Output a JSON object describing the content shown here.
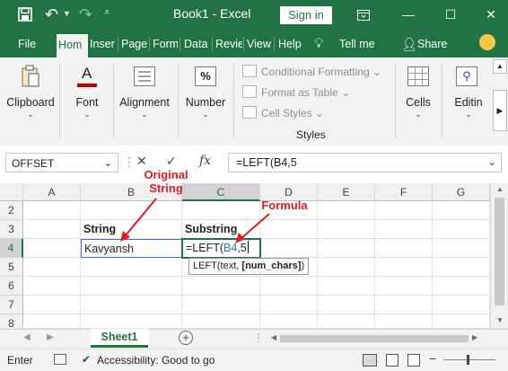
{
  "titlebar": {
    "title": "Book1 - Excel",
    "sign_in": "Sign in",
    "accent": "#217346"
  },
  "tabs": [
    "File",
    "Hom",
    "Inser",
    "Page",
    "Form",
    "Data",
    "Revie",
    "View",
    "Help"
  ],
  "tell_me": "Tell me",
  "share": "Share",
  "ribbon": {
    "clipboard": "Clipboard",
    "font": "Font",
    "alignment": "Alignment",
    "number": "Number",
    "font_icon_text": "A",
    "number_icon_text": "%",
    "styles": {
      "conditional_formatting": "Conditional Formatting",
      "format_as_table": "Format as Table",
      "cell_styles": "Cell Styles",
      "label": "Styles"
    },
    "cells": "Cells",
    "editing": "Editin"
  },
  "formula_bar": {
    "name_box": "OFFSET",
    "fx": "fx",
    "formula": "=LEFT(B4,5"
  },
  "columns": [
    "A",
    "B",
    "C",
    "D",
    "E",
    "F",
    "G"
  ],
  "rows": [
    "2",
    "3",
    "4",
    "5",
    "6",
    "7",
    "8"
  ],
  "cells": {
    "B3": "String",
    "C3": "Substring",
    "B4": "Kavyansh",
    "C4_prefix": "=LEFT(",
    "C4_ref": "B4",
    "C4_suffix": ",5"
  },
  "tooltip": {
    "func": "LEFT(text, ",
    "bold_arg": "[num_chars]",
    "close": ")"
  },
  "annotations": {
    "original_line1": "Original",
    "original_line2": "String",
    "formula": "Formula",
    "color": "#e11b22"
  },
  "sheet_tab": "Sheet1",
  "status": {
    "mode": "Enter",
    "accessibility": "Accessibility: Good to go"
  }
}
